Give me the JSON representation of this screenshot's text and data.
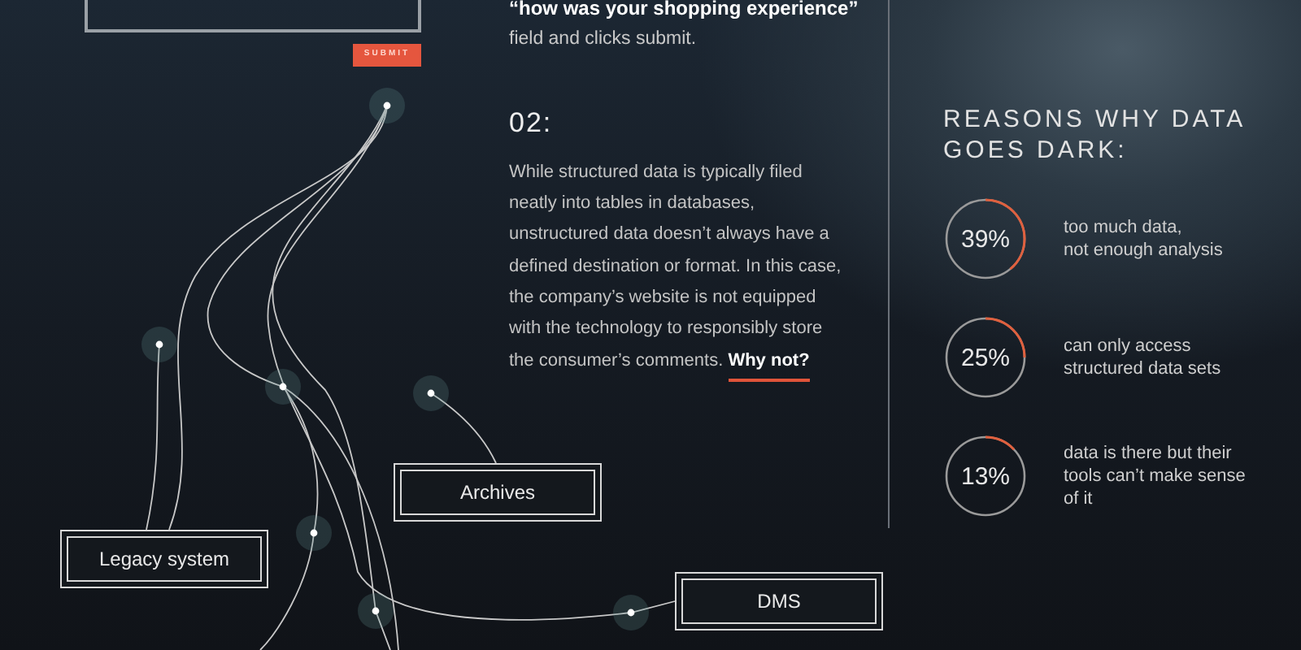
{
  "form": {
    "submit": "SUBMIT"
  },
  "step1": {
    "quote": "“how was your shopping experience”",
    "text": "field and clicks submit."
  },
  "step2": {
    "number": "02:",
    "text": "While structured data is typically filed neatly into tables in databases, unstructured data doesn’t always have a defined destination or format. In this case, the company’s website is not equipped with the technology to responsibly store the consumer’s comments. **Why not?**"
  },
  "reasons": {
    "title": "REASONS WHY DATA GOES DARK:",
    "items": [
      {
        "value": "39%",
        "label": "too much data,\nnot enough analysis"
      },
      {
        "value": "25%",
        "label": "can only access\nstructured data sets"
      },
      {
        "value": "13%",
        "label": "data is there but their\ntools can’t make sense\nof it"
      }
    ]
  },
  "diagram": {
    "nodes": [
      {
        "label": "Archives"
      },
      {
        "label": "Legacy system"
      },
      {
        "label": "DMS"
      }
    ]
  }
}
